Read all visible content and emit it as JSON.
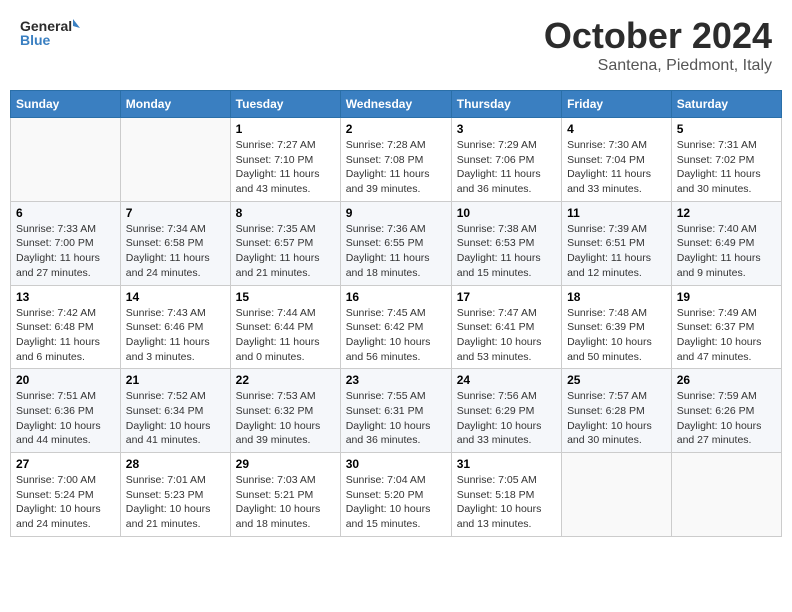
{
  "header": {
    "logo_line1": "General",
    "logo_line2": "Blue",
    "month": "October 2024",
    "location": "Santena, Piedmont, Italy"
  },
  "days_of_week": [
    "Sunday",
    "Monday",
    "Tuesday",
    "Wednesday",
    "Thursday",
    "Friday",
    "Saturday"
  ],
  "weeks": [
    [
      {
        "day": "",
        "info": ""
      },
      {
        "day": "",
        "info": ""
      },
      {
        "day": "1",
        "info": "Sunrise: 7:27 AM\nSunset: 7:10 PM\nDaylight: 11 hours and 43 minutes."
      },
      {
        "day": "2",
        "info": "Sunrise: 7:28 AM\nSunset: 7:08 PM\nDaylight: 11 hours and 39 minutes."
      },
      {
        "day": "3",
        "info": "Sunrise: 7:29 AM\nSunset: 7:06 PM\nDaylight: 11 hours and 36 minutes."
      },
      {
        "day": "4",
        "info": "Sunrise: 7:30 AM\nSunset: 7:04 PM\nDaylight: 11 hours and 33 minutes."
      },
      {
        "day": "5",
        "info": "Sunrise: 7:31 AM\nSunset: 7:02 PM\nDaylight: 11 hours and 30 minutes."
      }
    ],
    [
      {
        "day": "6",
        "info": "Sunrise: 7:33 AM\nSunset: 7:00 PM\nDaylight: 11 hours and 27 minutes."
      },
      {
        "day": "7",
        "info": "Sunrise: 7:34 AM\nSunset: 6:58 PM\nDaylight: 11 hours and 24 minutes."
      },
      {
        "day": "8",
        "info": "Sunrise: 7:35 AM\nSunset: 6:57 PM\nDaylight: 11 hours and 21 minutes."
      },
      {
        "day": "9",
        "info": "Sunrise: 7:36 AM\nSunset: 6:55 PM\nDaylight: 11 hours and 18 minutes."
      },
      {
        "day": "10",
        "info": "Sunrise: 7:38 AM\nSunset: 6:53 PM\nDaylight: 11 hours and 15 minutes."
      },
      {
        "day": "11",
        "info": "Sunrise: 7:39 AM\nSunset: 6:51 PM\nDaylight: 11 hours and 12 minutes."
      },
      {
        "day": "12",
        "info": "Sunrise: 7:40 AM\nSunset: 6:49 PM\nDaylight: 11 hours and 9 minutes."
      }
    ],
    [
      {
        "day": "13",
        "info": "Sunrise: 7:42 AM\nSunset: 6:48 PM\nDaylight: 11 hours and 6 minutes."
      },
      {
        "day": "14",
        "info": "Sunrise: 7:43 AM\nSunset: 6:46 PM\nDaylight: 11 hours and 3 minutes."
      },
      {
        "day": "15",
        "info": "Sunrise: 7:44 AM\nSunset: 6:44 PM\nDaylight: 11 hours and 0 minutes."
      },
      {
        "day": "16",
        "info": "Sunrise: 7:45 AM\nSunset: 6:42 PM\nDaylight: 10 hours and 56 minutes."
      },
      {
        "day": "17",
        "info": "Sunrise: 7:47 AM\nSunset: 6:41 PM\nDaylight: 10 hours and 53 minutes."
      },
      {
        "day": "18",
        "info": "Sunrise: 7:48 AM\nSunset: 6:39 PM\nDaylight: 10 hours and 50 minutes."
      },
      {
        "day": "19",
        "info": "Sunrise: 7:49 AM\nSunset: 6:37 PM\nDaylight: 10 hours and 47 minutes."
      }
    ],
    [
      {
        "day": "20",
        "info": "Sunrise: 7:51 AM\nSunset: 6:36 PM\nDaylight: 10 hours and 44 minutes."
      },
      {
        "day": "21",
        "info": "Sunrise: 7:52 AM\nSunset: 6:34 PM\nDaylight: 10 hours and 41 minutes."
      },
      {
        "day": "22",
        "info": "Sunrise: 7:53 AM\nSunset: 6:32 PM\nDaylight: 10 hours and 39 minutes."
      },
      {
        "day": "23",
        "info": "Sunrise: 7:55 AM\nSunset: 6:31 PM\nDaylight: 10 hours and 36 minutes."
      },
      {
        "day": "24",
        "info": "Sunrise: 7:56 AM\nSunset: 6:29 PM\nDaylight: 10 hours and 33 minutes."
      },
      {
        "day": "25",
        "info": "Sunrise: 7:57 AM\nSunset: 6:28 PM\nDaylight: 10 hours and 30 minutes."
      },
      {
        "day": "26",
        "info": "Sunrise: 7:59 AM\nSunset: 6:26 PM\nDaylight: 10 hours and 27 minutes."
      }
    ],
    [
      {
        "day": "27",
        "info": "Sunrise: 7:00 AM\nSunset: 5:24 PM\nDaylight: 10 hours and 24 minutes."
      },
      {
        "day": "28",
        "info": "Sunrise: 7:01 AM\nSunset: 5:23 PM\nDaylight: 10 hours and 21 minutes."
      },
      {
        "day": "29",
        "info": "Sunrise: 7:03 AM\nSunset: 5:21 PM\nDaylight: 10 hours and 18 minutes."
      },
      {
        "day": "30",
        "info": "Sunrise: 7:04 AM\nSunset: 5:20 PM\nDaylight: 10 hours and 15 minutes."
      },
      {
        "day": "31",
        "info": "Sunrise: 7:05 AM\nSunset: 5:18 PM\nDaylight: 10 hours and 13 minutes."
      },
      {
        "day": "",
        "info": ""
      },
      {
        "day": "",
        "info": ""
      }
    ]
  ]
}
